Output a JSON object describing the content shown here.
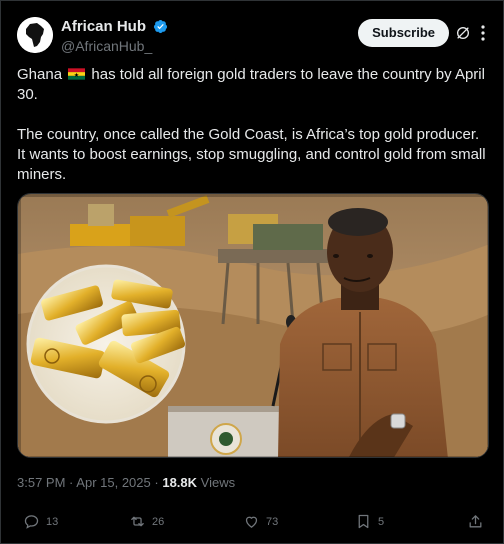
{
  "author": {
    "display_name": "African Hub",
    "handle": "@AfricanHub_",
    "verified_icon": "verified-badge-icon",
    "verified_color": "#1d9bf0"
  },
  "header": {
    "subscribe_label": "Subscribe",
    "grok_icon": "grok-icon",
    "more_icon": "more-icon"
  },
  "post": {
    "paragraph1_before_flag": "Ghana",
    "flag_icon": "ghana-flag-icon",
    "paragraph1_after_flag": "has told all foreign gold traders to leave the country by April 30.",
    "paragraph2": "The country, once called the Gold Coast, is Africa’s top gold producer. It wants to boost earnings, stop smuggling, and control gold from small miners."
  },
  "media": {
    "description_icon": "photo-gold-mining-and-speaker"
  },
  "meta": {
    "time": "3:57 PM",
    "separator": "·",
    "date": "Apr 15, 2025",
    "views_count": "18.8K",
    "views_label": "Views"
  },
  "actions": {
    "replies": "13",
    "reposts": "26",
    "likes": "73",
    "bookmarks": "5"
  },
  "colors": {
    "background": "#000000",
    "text": "#e7e9ea",
    "secondary": "#71767b",
    "subscribe_bg": "#eff3f4"
  }
}
